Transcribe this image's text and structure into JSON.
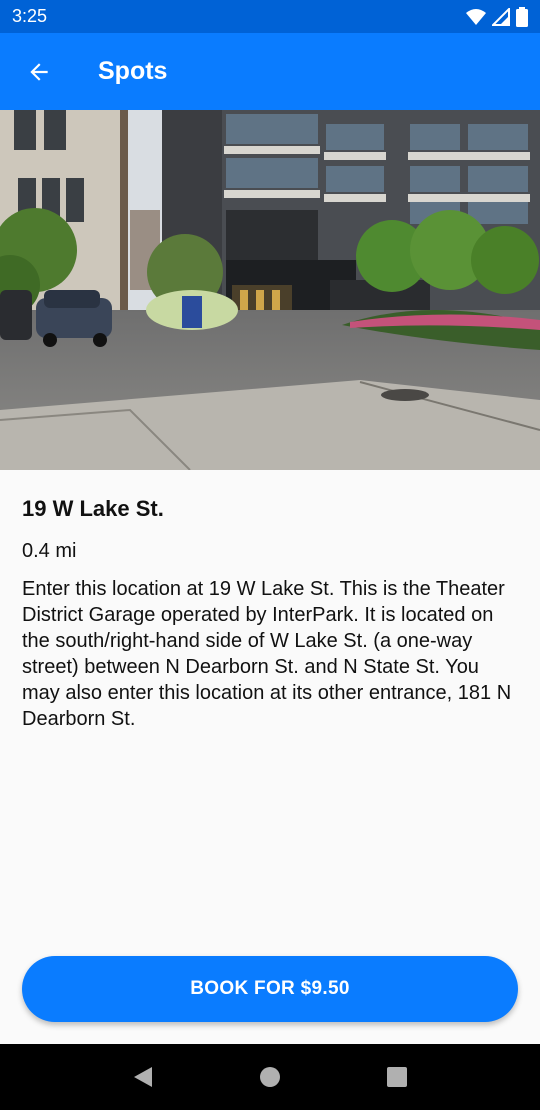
{
  "status_bar": {
    "time": "3:25",
    "icons": [
      "wifi-icon",
      "signal-icon",
      "battery-icon"
    ]
  },
  "app_bar": {
    "title": "Spots",
    "back_icon": "arrow-back-icon"
  },
  "spot": {
    "image_icon": "parking-garage-photo",
    "title": "19 W Lake St.",
    "distance": "0.4 mi",
    "description": "Enter this location at 19 W Lake St. This is the Theater District Garage operated by InterPark. It is located on the south/right-hand side of W Lake St. (a one-way street) between N Dearborn St. and N State St. You may also enter this location at its other entrance, 181 N Dearborn St."
  },
  "actions": {
    "book_label": "BOOK FOR $9.50"
  },
  "colors": {
    "status_bar": "#0062d6",
    "primary": "#0a7cff",
    "background": "#fafafa"
  },
  "nav_bar": {
    "icons": [
      "back-triangle-icon",
      "home-circle-icon",
      "recents-square-icon"
    ]
  }
}
